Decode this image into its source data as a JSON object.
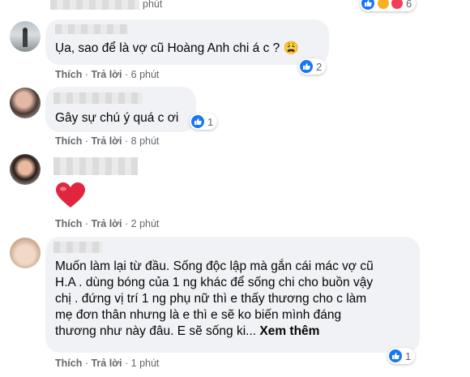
{
  "comments": [
    {
      "text": "Ụa, sao để là vợ cũ Hoàng Anh chi á c ? 😩",
      "reactions": "2",
      "actions": {
        "like": "Thích",
        "reply": "Trả lời",
        "time": "6 phút"
      }
    },
    {
      "text": "Gây sự chú ý quá c ơi",
      "reactions": "1",
      "actions": {
        "like": "Thích",
        "reply": "Trả lời",
        "time": "8 phút"
      }
    },
    {
      "text": "❤️",
      "actions": {
        "like": "Thích",
        "reply": "Trả lời",
        "time": "2 phút"
      }
    },
    {
      "text_lines": [
        "Muốn làm lại từ đầu. Sống độc lập mà gắn cái mác vợ cũ",
        "H.A . dùng bóng của 1 ng khác để sống chi cho buồn vậy",
        "chị . đứng vị trí 1 ng phụ nữ thì e thấy thương cho c làm",
        "mẹ đơn thân nhưng là e thì e sẽ ko biến mình đáng",
        "thương như này đâu. E sẽ sống ki..."
      ],
      "see_more": "Xem thêm",
      "reactions": "1",
      "actions": {
        "like": "Thích",
        "reply": "Trả lời",
        "time": "1 phút"
      }
    }
  ],
  "top_fragment": {
    "time": "phút",
    "reactions": "6"
  },
  "colors": {
    "bubble": "#f0f2f5",
    "like": "#1877f2",
    "meta": "#65676b",
    "heart": "#e0263f"
  }
}
